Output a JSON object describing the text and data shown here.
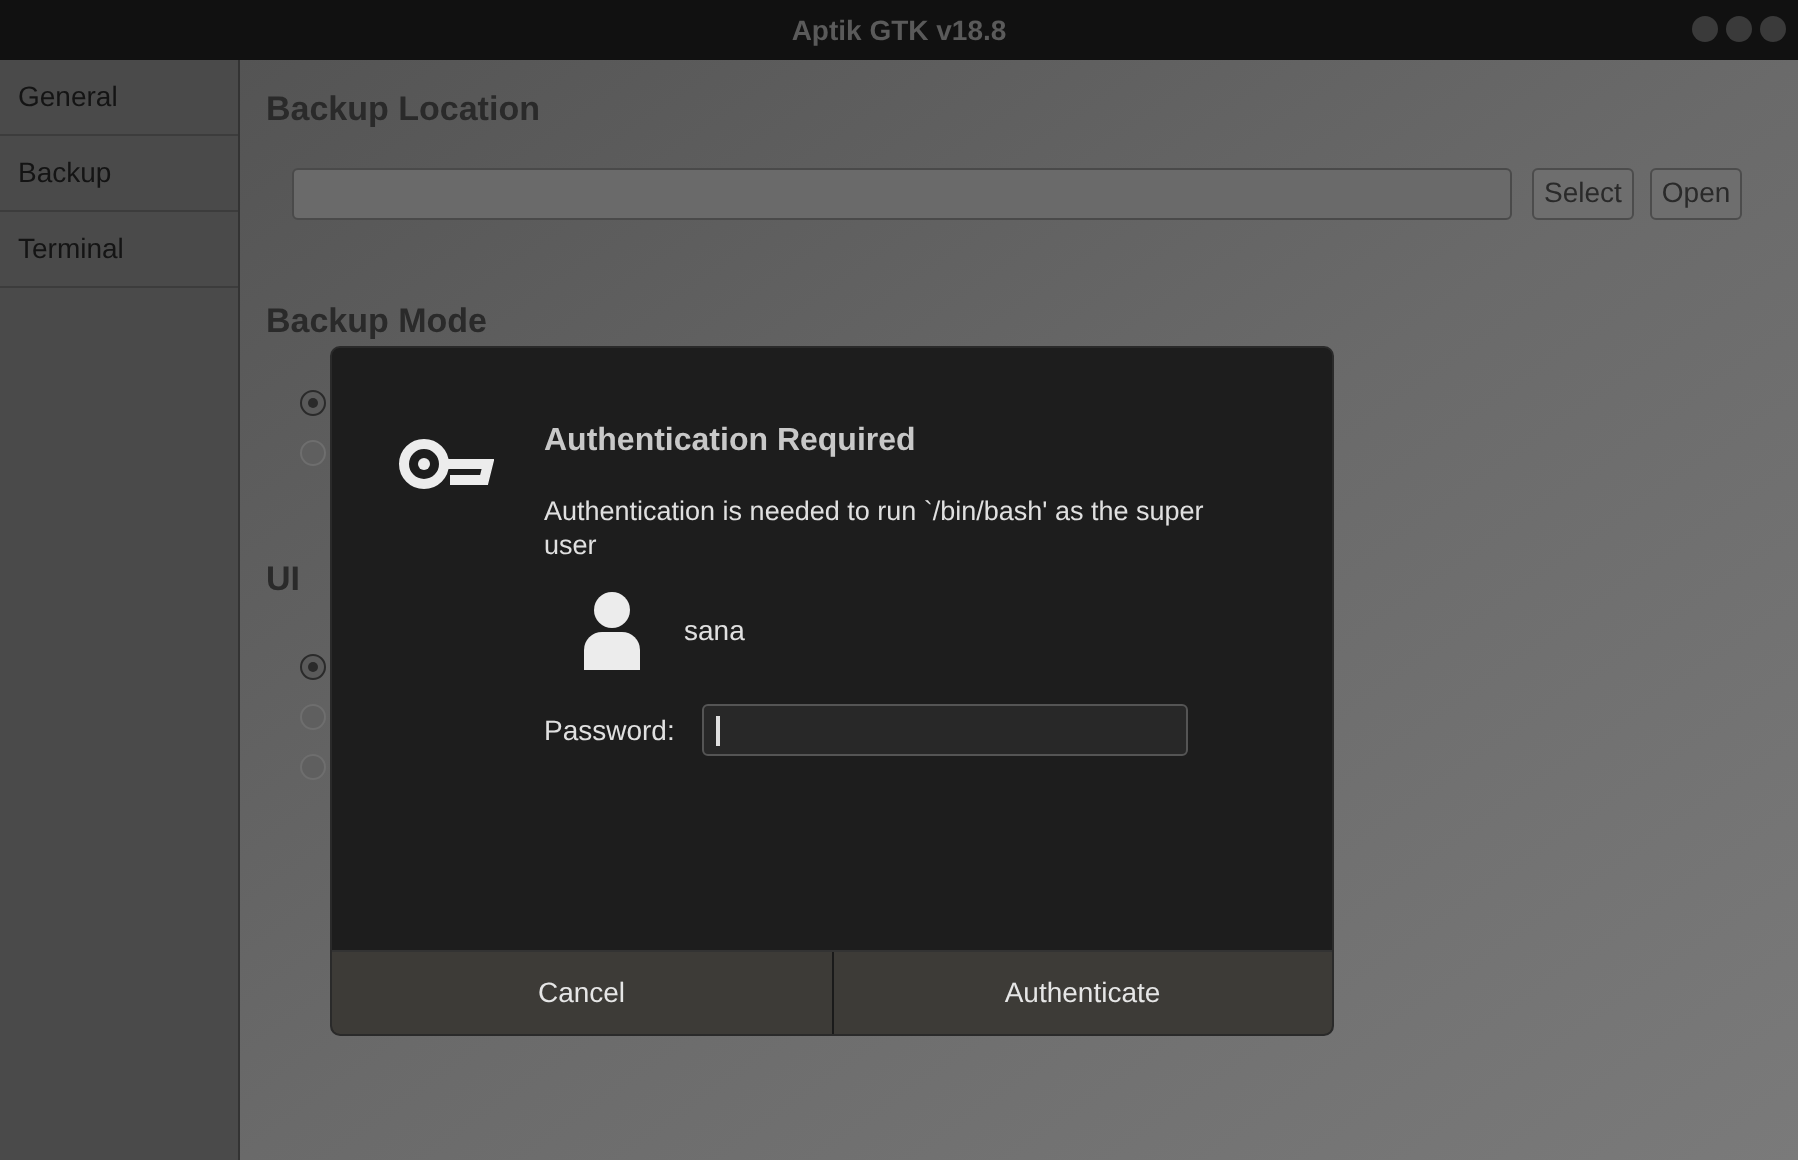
{
  "window": {
    "title": "Aptik GTK v18.8"
  },
  "sidebar": {
    "items": [
      {
        "label": "General"
      },
      {
        "label": "Backup"
      },
      {
        "label": "Terminal"
      }
    ]
  },
  "backup_location": {
    "heading": "Backup Location",
    "buttons": [
      "Select",
      "Open"
    ]
  },
  "backup_mode": {
    "heading": "Backup Mode",
    "options": [
      {
        "selected": true
      },
      {
        "selected": false
      }
    ]
  },
  "ui_mode": {
    "heading": "UI",
    "options": [
      {
        "selected": true
      },
      {
        "selected": false
      },
      {
        "selected": false
      }
    ]
  },
  "dialog": {
    "title": "Authentication Required",
    "message": "Authentication is needed to run `/bin/bash' as the super user",
    "user": "sana",
    "password_label": "Password:",
    "buttons": [
      "Cancel",
      "Authenticate"
    ]
  }
}
